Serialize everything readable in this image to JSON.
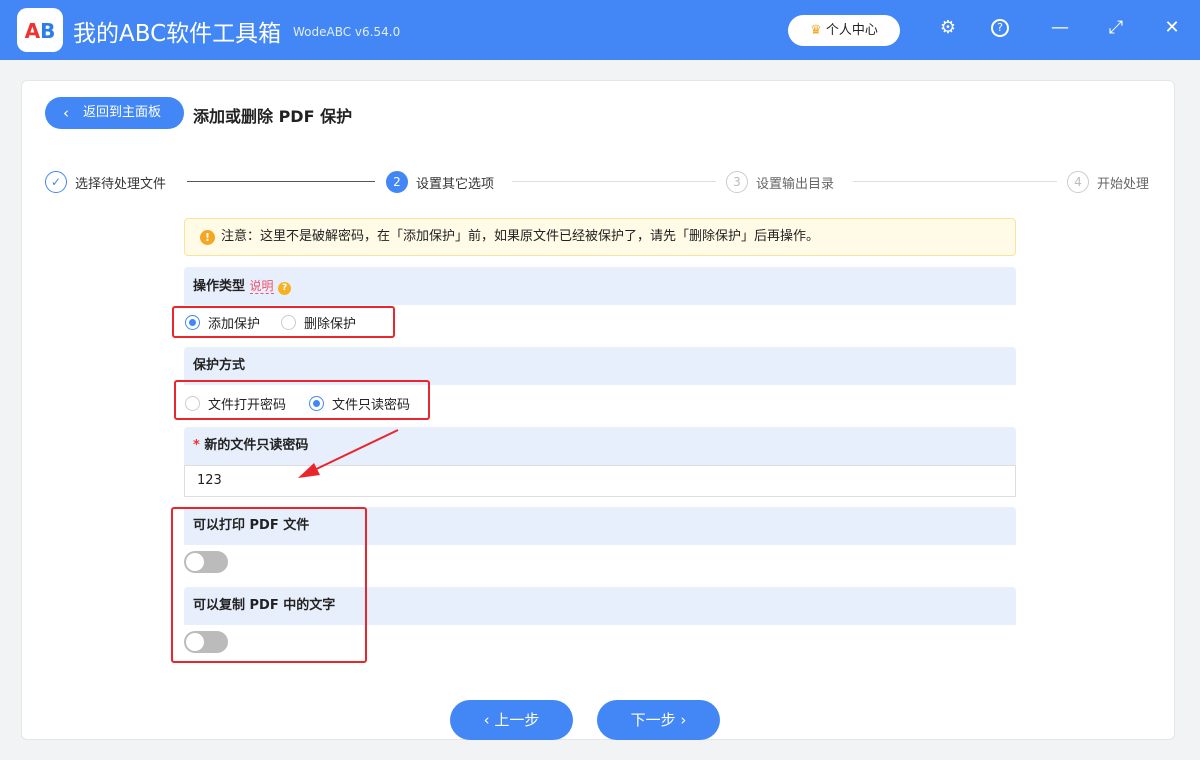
{
  "app": {
    "logo_text": "AB",
    "title": "我的ABC软件工具箱",
    "version": "WodeABC v6.54.0",
    "user_center": "个人中心",
    "user_center_icon": "crown-icon"
  },
  "header": {
    "back_label": "返回到主面板",
    "page_title": "添加或删除 PDF 保护"
  },
  "steps": [
    {
      "num": "✓",
      "label": "选择待处理文件",
      "state": "done"
    },
    {
      "num": "2",
      "label": "设置其它选项",
      "state": "active"
    },
    {
      "num": "3",
      "label": "设置输出目录",
      "state": "pending"
    },
    {
      "num": "4",
      "label": "开始处理",
      "state": "pending"
    }
  ],
  "notice": "注意：这里不是破解密码，在「添加保护」前，如果原文件已经被保护了，请先「删除保护」后再操作。",
  "op_type": {
    "label": "操作类型",
    "help": "说明",
    "options": [
      "添加保护",
      "删除保护"
    ],
    "selected": 0
  },
  "protect_mode": {
    "label": "保护方式",
    "options": [
      "文件打开密码",
      "文件只读密码"
    ],
    "selected": 1
  },
  "password": {
    "required_mark": "*",
    "label": "新的文件只读密码",
    "value": "123"
  },
  "print": {
    "label": "可以打印 PDF 文件",
    "enabled": false
  },
  "copy": {
    "label": "可以复制 PDF 中的文字",
    "enabled": false
  },
  "footer": {
    "prev": "上一步",
    "next": "下一步"
  },
  "colors": {
    "accent": "#4287f5",
    "highlight": "#e8262c"
  }
}
